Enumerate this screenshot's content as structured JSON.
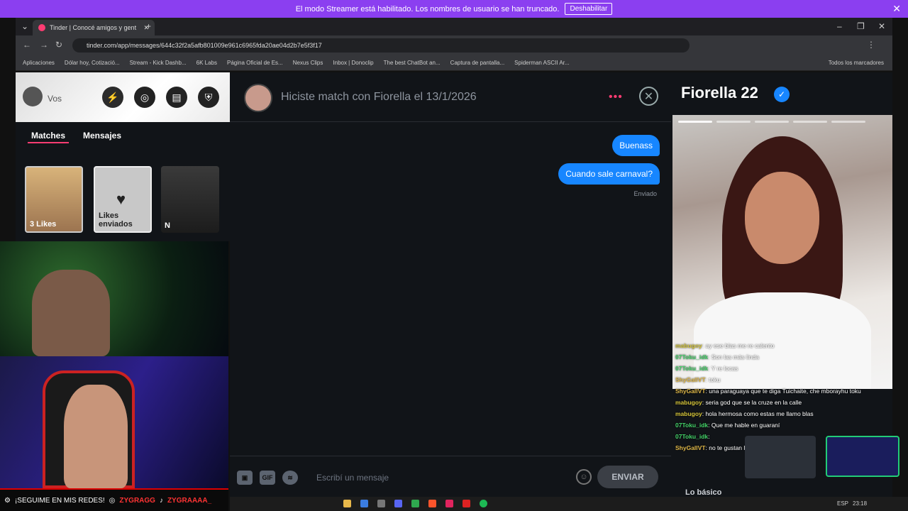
{
  "streamer_bar": {
    "message": "El modo Streamer está habilitado. Los nombres de usuario se han truncado.",
    "button": "Deshabilitar"
  },
  "browser": {
    "tab_title": "Tinder | Conocé amigos y gent",
    "url": "tinder.com/app/messages/644c32f2a5afb801009e961c6965fda20ae04d2b7e5f3f17",
    "bookmarks": [
      "Aplicaciones",
      "Dólar hoy, Cotizació...",
      "Stream - Kick Dashb...",
      "6K Labs",
      "Página Oficial de Es...",
      "Nexus Clips",
      "Inbox | Donoclip",
      "The best ChatBot an...",
      "Captura de pantalla...",
      "Spiderman ASCII Ar..."
    ],
    "all_bookmarks": "Todos los marcadores"
  },
  "sidebar": {
    "user": "Vos",
    "tabs": [
      "Matches",
      "Mensajes"
    ],
    "cards": [
      "3 Likes",
      "Likes enviados",
      "N"
    ]
  },
  "chat": {
    "header": "Hiciste match con Fiorella el 13/1/2026",
    "messages": [
      "Buenass",
      "Cuando sale carnaval?"
    ],
    "status": "Enviado",
    "input_placeholder": "Escribí un mensaje",
    "gif_label": "GIF",
    "send": "ENVIAR"
  },
  "profile": {
    "name_age": "Fiorella 22",
    "section": "Lo básico"
  },
  "twitch_chat": [
    {
      "user": "mabugoy",
      "msg": ": ay ese blas me re calento"
    },
    {
      "user": "07Toku_idk",
      "msg": ": Son las más linda"
    },
    {
      "user": "07Toku_idk",
      "msg": ": Y re locas"
    },
    {
      "user": "ShyGallVT",
      "msg": ": toku"
    },
    {
      "user": "ShyGallVT",
      "msg": ": una paraguaya que te diga Tuichaite, che mborayhu toku"
    },
    {
      "user": "mabugoy",
      "msg": ": seria god que se la cruze en la calle"
    },
    {
      "user": "mabugoy",
      "msg": ": hola hermosa como estas me llamo blas"
    },
    {
      "user": "07Toku_idk",
      "msg": ": Que me hable en guaraní"
    },
    {
      "user": "07Toku_idk",
      "msg": ":"
    },
    {
      "user": "ShyGallVT",
      "msg": ": no te gustan los guiso de lentejas?"
    }
  ],
  "overlay": {
    "follow_text": "¡SEGUIME EN MIS REDES!",
    "instagram": "ZYGRAGG",
    "tiktok": "ZYGRAAAA_"
  },
  "taskbar": {
    "lang": "ESP",
    "time": "23:18"
  },
  "colors": {
    "tinder_pink": "#fe3c72",
    "bubble_blue": "#1786ff",
    "streamer_purple": "#8b3ff0"
  }
}
